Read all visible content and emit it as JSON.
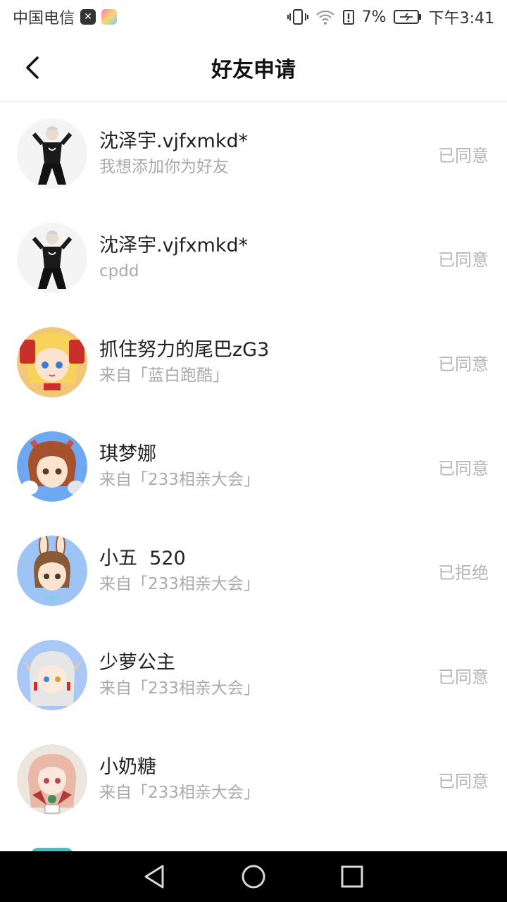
{
  "status_bar": {
    "carrier": "中国电信",
    "battery": "7%",
    "time": "下午3:41"
  },
  "header": {
    "title": "好友申请"
  },
  "requests": [
    {
      "name": "沈泽宇.vjfxmkd*",
      "message": "我想添加你为好友",
      "status": "已同意",
      "avatar": "avatar-dark-outfit"
    },
    {
      "name": "沈泽宇.vjfxmkd*",
      "message": "cpdd",
      "status": "已同意",
      "avatar": "avatar-dark-outfit"
    },
    {
      "name": "抓住努力的尾巴zG3",
      "message": "来自「蓝白跑酷」",
      "status": "已同意",
      "avatar": "avatar-blonde"
    },
    {
      "name": "琪梦娜",
      "message": "来自「233相亲大会」",
      "status": "已同意",
      "avatar": "avatar-redhead"
    },
    {
      "name": "小五  520",
      "message": "来自「233相亲大会」",
      "status": "已拒绝",
      "avatar": "avatar-bunny"
    },
    {
      "name": "少萝公主",
      "message": "来自「233相亲大会」",
      "status": "已同意",
      "avatar": "avatar-silver"
    },
    {
      "name": "小奶糖",
      "message": "来自「233相亲大会」",
      "status": "已同意",
      "avatar": "avatar-pink"
    }
  ],
  "colors": {
    "status_text": "#b5b5b5",
    "sub_text": "#aaaaaa",
    "divider": "#e6e6e6"
  }
}
